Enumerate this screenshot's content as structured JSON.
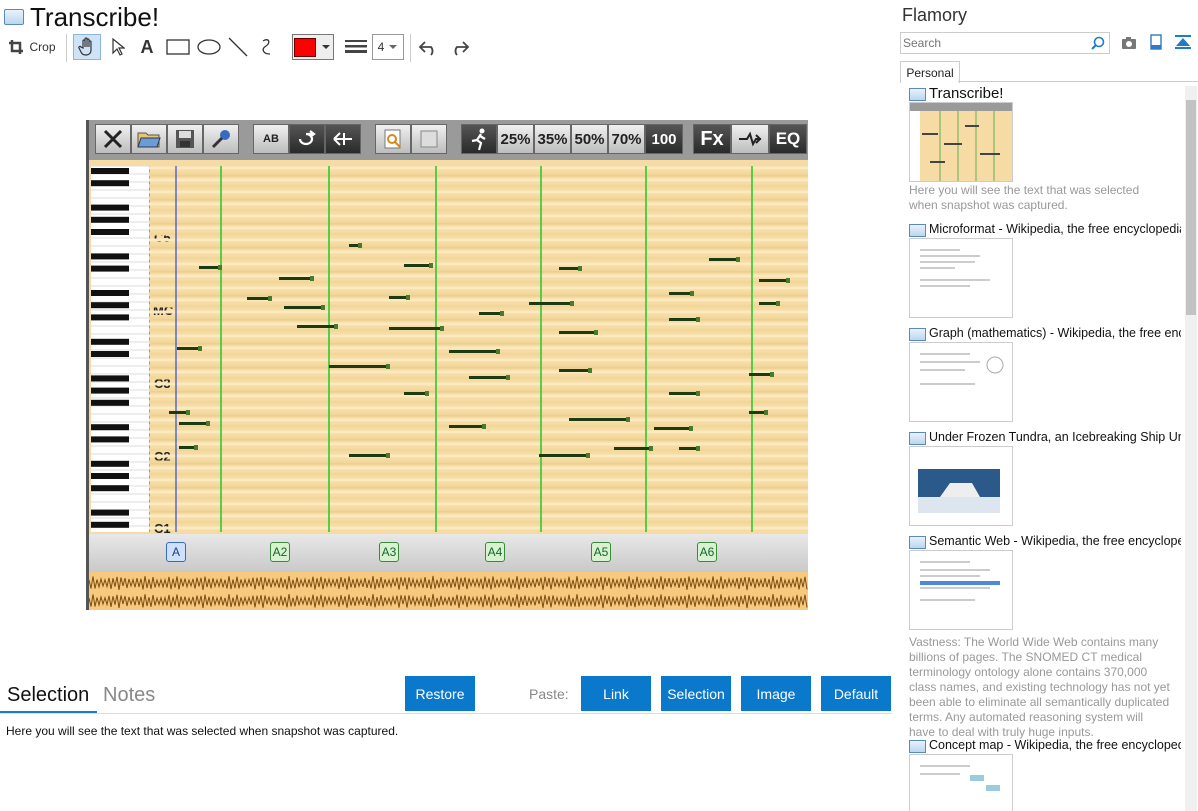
{
  "app": {
    "title": "Transcribe!"
  },
  "toolbar": {
    "crop_label": "Crop",
    "text_tool": "A",
    "line_width": "4",
    "color": "#ff0000"
  },
  "transcribe": {
    "speed_buttons": [
      "25%",
      "35%",
      "50%",
      "70%",
      "100"
    ],
    "fx_label": "Fx",
    "eq_label": "EQ",
    "ab_label": "AB",
    "note_labels": [
      "C5",
      "MC",
      "C3",
      "C2",
      "C1"
    ],
    "markers": [
      "A",
      "A2",
      "A3",
      "A4",
      "A5",
      "A6"
    ]
  },
  "bottom": {
    "tabs": [
      "Selection",
      "Notes"
    ],
    "restore": "Restore",
    "paste_label": "Paste:",
    "paste_buttons": [
      "Link",
      "Selection",
      "Image",
      "Default"
    ],
    "selected_text": "Here you will see the text that was selected when snapshot was captured."
  },
  "flamory": {
    "title": "Flamory",
    "search_placeholder": "Search",
    "tab": "Personal",
    "items": [
      {
        "title": "Transcribe!",
        "desc": "Here you will see the text that was selected when snapshot was captured."
      },
      {
        "title": "Microformat - Wikipedia, the free encyclopedia",
        "desc": ""
      },
      {
        "title": "Graph (mathematics) - Wikipedia, the free encyc",
        "desc": ""
      },
      {
        "title": "Under Frozen Tundra, an Icebreaking Ship Unco",
        "desc": ""
      },
      {
        "title": "Semantic Web - Wikipedia, the free encycloped",
        "desc": "Vastness: The World Wide Web contains many billions of pages. The SNOMED CT medical terminology ontology alone contains 370,000 class names, and existing technology has not yet been able to eliminate all semantically duplicated terms. Any automated reasoning system will have to deal with truly huge inputs."
      },
      {
        "title": "Concept map - Wikipedia, the free encyclopedi",
        "desc": ""
      }
    ]
  }
}
